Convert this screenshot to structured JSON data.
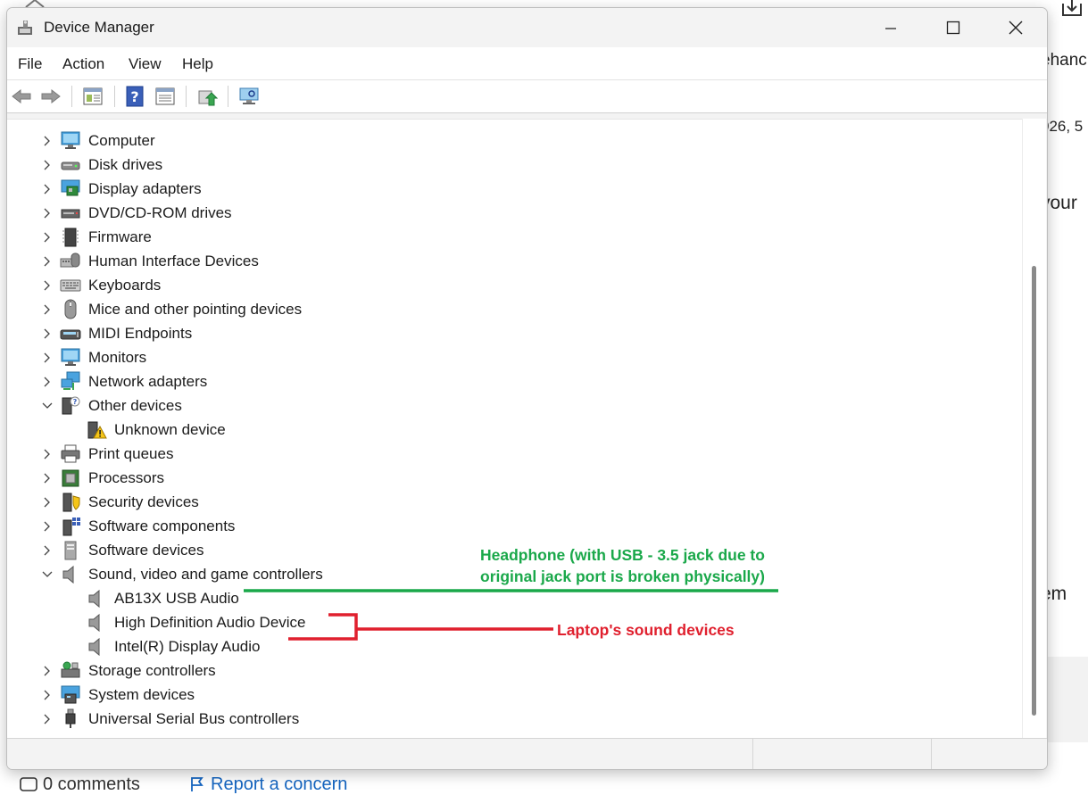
{
  "window": {
    "title": "Device Manager",
    "menu": [
      "File",
      "Action",
      "View",
      "Help"
    ]
  },
  "tree": [
    {
      "label": "Computer",
      "icon": "monitor-icon",
      "expanded": false,
      "level": 0
    },
    {
      "label": "Disk drives",
      "icon": "disk-drive-icon",
      "expanded": false,
      "level": 0
    },
    {
      "label": "Display adapters",
      "icon": "display-adapter-icon",
      "expanded": false,
      "level": 0
    },
    {
      "label": "DVD/CD-ROM drives",
      "icon": "dvd-drive-icon",
      "expanded": false,
      "level": 0
    },
    {
      "label": "Firmware",
      "icon": "firmware-chip-icon",
      "expanded": false,
      "level": 0
    },
    {
      "label": "Human Interface Devices",
      "icon": "hid-icon",
      "expanded": false,
      "level": 0
    },
    {
      "label": "Keyboards",
      "icon": "keyboard-icon",
      "expanded": false,
      "level": 0
    },
    {
      "label": "Mice and other pointing devices",
      "icon": "mouse-icon",
      "expanded": false,
      "level": 0
    },
    {
      "label": "MIDI Endpoints",
      "icon": "midi-icon",
      "expanded": false,
      "level": 0
    },
    {
      "label": "Monitors",
      "icon": "monitor-icon",
      "expanded": false,
      "level": 0
    },
    {
      "label": "Network adapters",
      "icon": "network-adapter-icon",
      "expanded": false,
      "level": 0
    },
    {
      "label": "Other devices",
      "icon": "unknown-device-icon",
      "expanded": true,
      "level": 0
    },
    {
      "label": "Unknown device",
      "icon": "warning-device-icon",
      "level": 1
    },
    {
      "label": "Print queues",
      "icon": "printer-icon",
      "expanded": false,
      "level": 0
    },
    {
      "label": "Processors",
      "icon": "processor-icon",
      "expanded": false,
      "level": 0
    },
    {
      "label": "Security devices",
      "icon": "security-device-icon",
      "expanded": false,
      "level": 0
    },
    {
      "label": "Software components",
      "icon": "software-component-icon",
      "expanded": false,
      "level": 0
    },
    {
      "label": "Software devices",
      "icon": "software-device-icon",
      "expanded": false,
      "level": 0
    },
    {
      "label": "Sound, video and game controllers",
      "icon": "speaker-icon",
      "expanded": true,
      "level": 0
    },
    {
      "label": "AB13X USB Audio",
      "icon": "speaker-icon",
      "level": 1
    },
    {
      "label": "High Definition Audio Device",
      "icon": "speaker-icon",
      "level": 1
    },
    {
      "label": "Intel(R) Display Audio",
      "icon": "speaker-icon",
      "level": 1
    },
    {
      "label": "Storage controllers",
      "icon": "storage-controller-icon",
      "expanded": false,
      "level": 0
    },
    {
      "label": "System devices",
      "icon": "system-device-icon",
      "expanded": false,
      "level": 0
    },
    {
      "label": "Universal Serial Bus controllers",
      "icon": "usb-icon",
      "expanded": false,
      "level": 0
    }
  ],
  "annotations": {
    "headphone_line1": "Headphone (with USB - 3.5 jack due to",
    "headphone_line2": "original jack port is broken physically)",
    "laptop_sound": "Laptop's sound devices",
    "green": "#1aa84a",
    "red": "#e0202e"
  },
  "background": {
    "frag_top": "ehanc",
    "frag_date": "026, 5",
    "frag_your": "your",
    "frag_em": "em",
    "comments": "0 comments",
    "report": "Report a concern"
  }
}
